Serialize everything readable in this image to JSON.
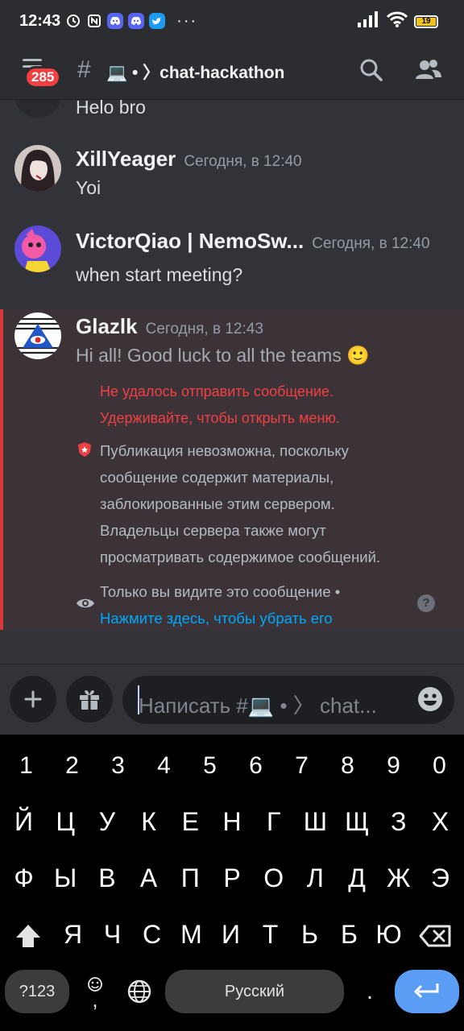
{
  "status_bar": {
    "time": "12:43",
    "battery_level": "19",
    "battery_fraction": 0.19,
    "icons": [
      "alarm-icon",
      "nfc-icon",
      "discord-icon",
      "discord-icon",
      "twitter-icon",
      "more-dots-icon",
      "signal-icon",
      "wifi-icon",
      "battery-icon"
    ],
    "more": "···"
  },
  "header": {
    "unread_badge": "285",
    "channel_prefix": "#",
    "channel_name": "💻 • 〉chat-hackathon",
    "icons": [
      "menu-icon",
      "search-icon",
      "members-icon"
    ]
  },
  "messages": [
    {
      "username": "",
      "text": "Helo bro"
    },
    {
      "username": "XillYeager",
      "timestamp": "Сегодня, в 12:40",
      "text": "Yoi"
    },
    {
      "username": "VictorQiao | NemoSw...",
      "timestamp": "Сегодня, в 12:40",
      "text": "when start meeting?"
    },
    {
      "username": "Glazlk",
      "timestamp": "Сегодня, в 12:43",
      "text": "Hi all! Good luck to all the teams 🙂"
    }
  ],
  "failed_message": {
    "error_line1": "Не удалось отправить сообщение.",
    "error_line2": "Удерживайте, чтобы открыть меню.",
    "notice_lines": [
      "Публикация невозможна, поскольку",
      "сообщение содержит материалы,",
      "заблокированные этим сервером.",
      "Владельцы сервера также могут",
      "просматривать содержимое сообщений."
    ],
    "only_you": "Только вы видите это сообщение •",
    "dismiss_link": "Нажмите здесь, чтобы убрать его",
    "help": "?"
  },
  "composer": {
    "placeholder": "Написать #💻 • 〉 chat...",
    "add_label": "+",
    "icons": [
      "plus-icon",
      "gift-icon",
      "emoji-icon"
    ]
  },
  "keyboard": {
    "row_numbers": [
      "1",
      "2",
      "3",
      "4",
      "5",
      "6",
      "7",
      "8",
      "9",
      "0"
    ],
    "row1": [
      "Й",
      "Ц",
      "У",
      "К",
      "Е",
      "Н",
      "Г",
      "Ш",
      "Щ",
      "З",
      "Х"
    ],
    "row2": [
      "Ф",
      "Ы",
      "В",
      "А",
      "П",
      "Р",
      "О",
      "Л",
      "Д",
      "Ж",
      "Э"
    ],
    "row3": [
      "Я",
      "Ч",
      "С",
      "М",
      "И",
      "Т",
      "Ь",
      "Б",
      "Ю"
    ],
    "symbols_key": "?123",
    "comma_key": ",",
    "space_label": "Русский",
    "period_key": ".",
    "icons": [
      "shift-icon",
      "backspace-icon",
      "emoji-icon",
      "globe-icon",
      "enter-icon"
    ]
  },
  "colors": {
    "background": "#313338",
    "header": "#2b2d31",
    "error_red": "#f23f42",
    "link_blue": "#00a8fc",
    "enter_key": "#5b9cf5"
  }
}
